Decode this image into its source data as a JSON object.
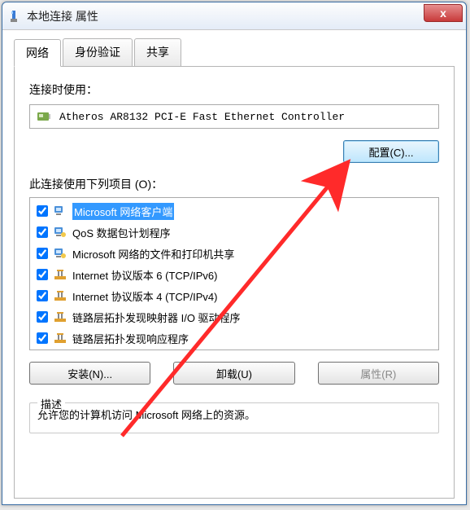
{
  "window": {
    "title": "本地连接 属性"
  },
  "tabs": {
    "network": "网络",
    "auth": "身份验证",
    "sharing": "共享"
  },
  "labels": {
    "connect_using": "连接时使用：",
    "items_used": "此连接使用下列项目 (O)：",
    "desc_legend": "描述"
  },
  "adapter": {
    "name": "Atheros AR8132 PCI-E Fast Ethernet Controller"
  },
  "buttons": {
    "configure": "配置(C)...",
    "install": "安装(N)...",
    "uninstall": "卸载(U)",
    "properties": "属性(R)"
  },
  "items": [
    {
      "label": "Microsoft 网络客户端",
      "checked": true,
      "icon": "client",
      "selected": true
    },
    {
      "label": "QoS 数据包计划程序",
      "checked": true,
      "icon": "service"
    },
    {
      "label": "Microsoft 网络的文件和打印机共享",
      "checked": true,
      "icon": "service"
    },
    {
      "label": "Internet 协议版本 6 (TCP/IPv6)",
      "checked": true,
      "icon": "protocol"
    },
    {
      "label": "Internet 协议版本 4 (TCP/IPv4)",
      "checked": true,
      "icon": "protocol"
    },
    {
      "label": "链路层拓扑发现映射器 I/O 驱动程序",
      "checked": true,
      "icon": "protocol"
    },
    {
      "label": "链路层拓扑发现响应程序",
      "checked": true,
      "icon": "protocol"
    }
  ],
  "description": "允许您的计算机访问 Microsoft 网络上的资源。"
}
